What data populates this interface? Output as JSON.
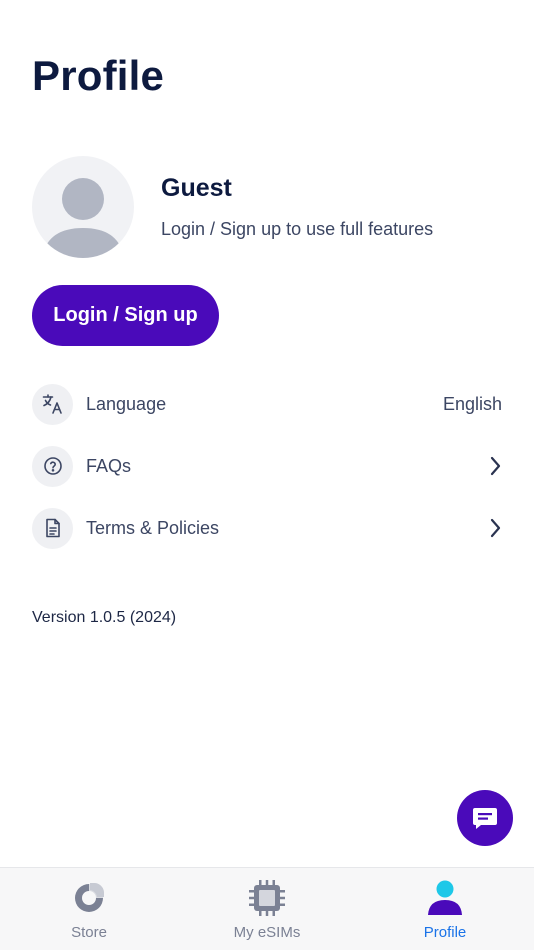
{
  "header": {
    "title": "Profile"
  },
  "profile": {
    "name": "Guest",
    "subtitle": "Login / Sign up to use full features",
    "login_button": "Login / Sign up"
  },
  "menu": {
    "items": [
      {
        "label": "Language",
        "value": "English",
        "icon": "translate-icon"
      },
      {
        "label": "FAQs",
        "value": "",
        "icon": "question-circle-icon"
      },
      {
        "label": "Terms & Policies",
        "value": "",
        "icon": "document-icon"
      }
    ]
  },
  "footer": {
    "version": "Version 1.0.5 (2024)"
  },
  "tabs": [
    {
      "label": "Store",
      "icon": "store-pie-icon",
      "active": false
    },
    {
      "label": "My eSIMs",
      "icon": "esim-chip-icon",
      "active": false
    },
    {
      "label": "Profile",
      "icon": "person-icon",
      "active": true
    }
  ],
  "colors": {
    "primary": "#4a0aba",
    "title": "#0d1a3f",
    "text": "#3c4663",
    "tab_active": "#1a73e8",
    "tab_inactive": "#7b8194",
    "profile_head_accent": "#1ec8e8"
  }
}
